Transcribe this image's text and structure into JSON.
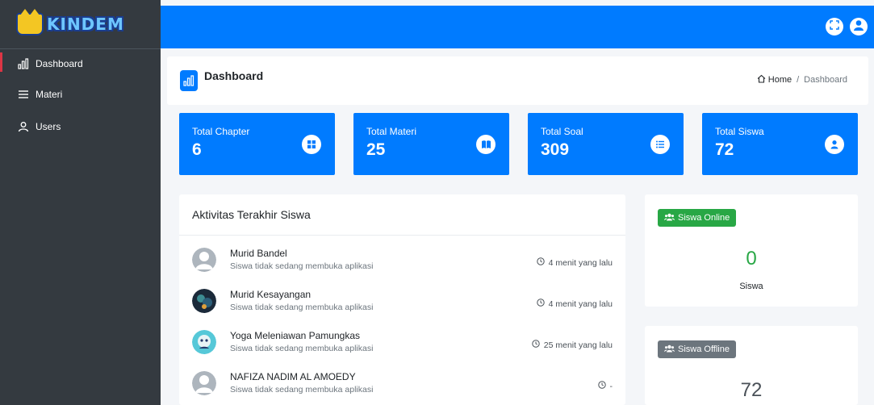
{
  "brand": {
    "name": "KINDEM"
  },
  "colors": {
    "primary": "#007bff",
    "sidebar": "#343a40",
    "success": "#28a745",
    "secondary": "#6c757d",
    "active_marker": "#dc3545"
  },
  "sidebar": {
    "items": [
      {
        "label": "Dashboard",
        "icon": "chart-bar-icon",
        "active": true
      },
      {
        "label": "Materi",
        "icon": "menu-lines-icon",
        "active": false
      },
      {
        "label": "Users",
        "icon": "user-icon",
        "active": false
      }
    ]
  },
  "topbar": {
    "icons": [
      "fullscreen-icon",
      "user-circle-icon"
    ]
  },
  "header": {
    "title": "Dashboard",
    "breadcrumb": {
      "home": "Home",
      "separator": "/",
      "current": "Dashboard"
    }
  },
  "stats": [
    {
      "label": "Total Chapter",
      "value": "6",
      "icon": "grid-icon"
    },
    {
      "label": "Total Materi",
      "value": "25",
      "icon": "book-icon"
    },
    {
      "label": "Total Soal",
      "value": "309",
      "icon": "list-icon"
    },
    {
      "label": "Total Siswa",
      "value": "72",
      "icon": "user-icon"
    }
  ],
  "activity": {
    "title": "Aktivitas Terakhir Siswa",
    "items": [
      {
        "name": "Murid Bandel",
        "status": "Siswa tidak sedang membuka aplikasi",
        "time": "4 menit yang lalu",
        "avatar": "default"
      },
      {
        "name": "Murid Kesayangan",
        "status": "Siswa tidak sedang membuka aplikasi",
        "time": "4 menit yang lalu",
        "avatar": "photo"
      },
      {
        "name": "Yoga Meleniawan Pamungkas",
        "status": "Siswa tidak sedang membuka aplikasi",
        "time": "25 menit yang lalu",
        "avatar": "photo"
      },
      {
        "name": "NAFIZA NADIM AL AMOEDY",
        "status": "Siswa tidak sedang membuka aplikasi",
        "time": "-",
        "avatar": "default"
      }
    ]
  },
  "online": {
    "badge": "Siswa Online",
    "count": "0",
    "unit": "Siswa"
  },
  "offline": {
    "badge": "Siswa Offline",
    "count": "72"
  }
}
